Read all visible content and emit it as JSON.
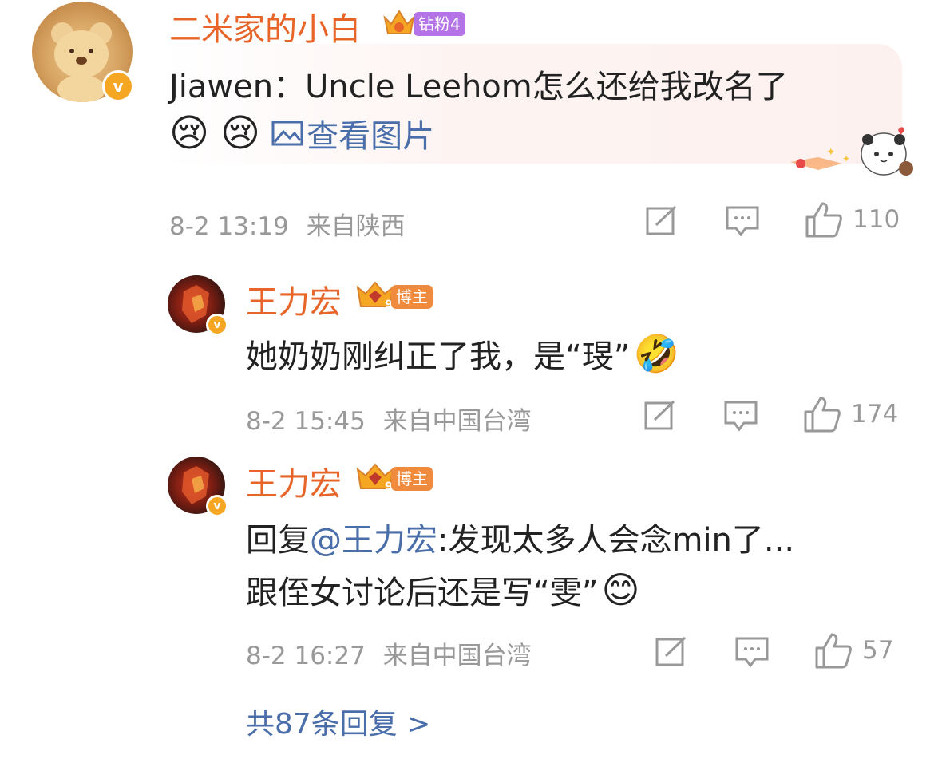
{
  "comments": [
    {
      "username": "二米家的小白",
      "badge": "钻粉4",
      "content_prefix": "Jiawen：Uncle Leehom怎么还给我改名了",
      "emoji_1": "😢",
      "emoji_2": "😢",
      "view_image": "查看图片",
      "time": "8-2 13:19",
      "location": "来自陕西",
      "likes": "110"
    },
    {
      "username": "王力宏",
      "badge": "博主",
      "content": "她奶奶刚纠正了我，是“琝”",
      "emoji": "🤣",
      "time": "8-2 15:45",
      "location": "来自中国台湾",
      "likes": "174"
    },
    {
      "username": "王力宏",
      "badge": "博主",
      "reply_prefix": "回复",
      "mention": "@王力宏",
      "line1_rest": ":发现太多人会念min了...",
      "line2": "跟侄女讨论后还是写“雯”",
      "emoji": "😊",
      "time": "8-2 16:27",
      "location": "来自中国台湾",
      "likes": "57"
    }
  ],
  "more_replies": "共87条回复 >",
  "colors": {
    "username": "#e8652a",
    "link": "#4a6ea9",
    "meta": "#999999",
    "badge_fan": "#b474e8",
    "badge_blogger": "#f08a3c"
  }
}
